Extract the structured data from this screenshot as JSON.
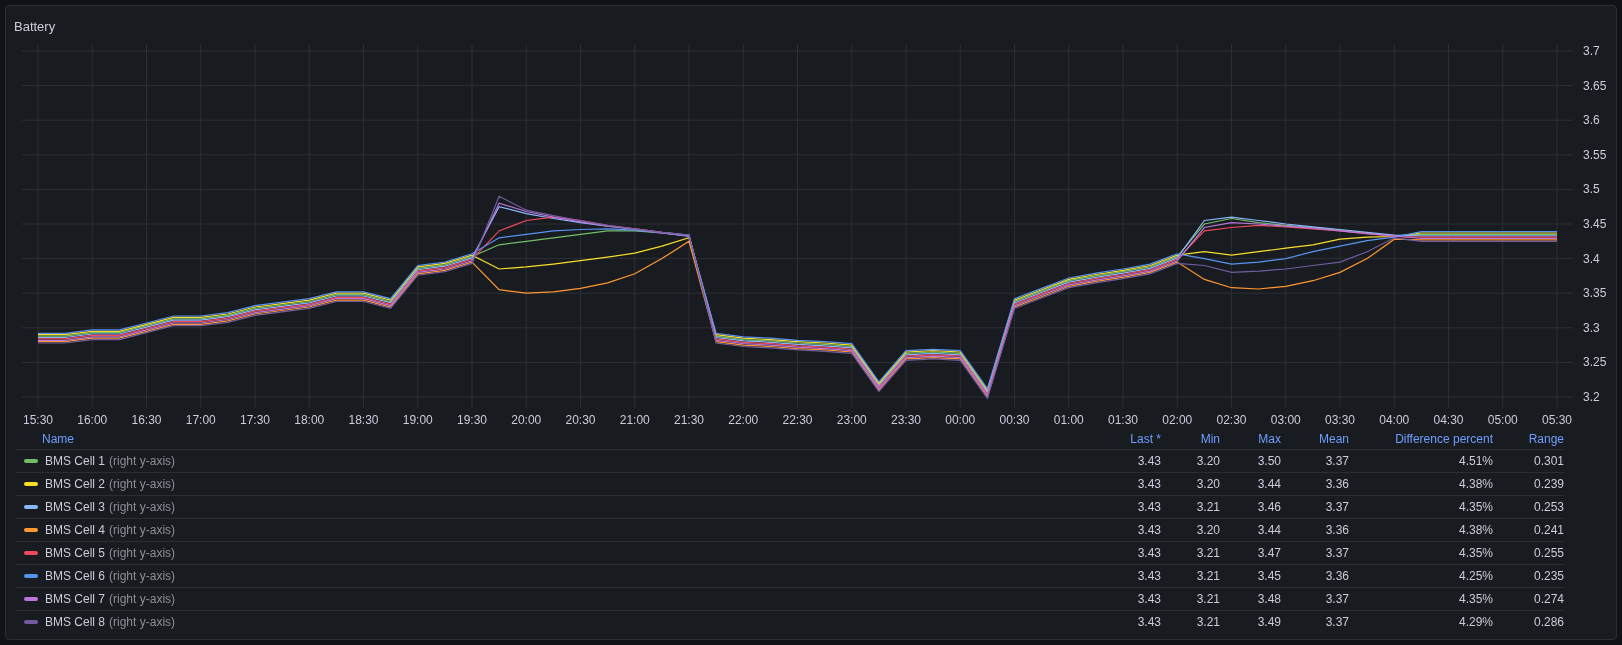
{
  "panel": {
    "title": "Battery"
  },
  "chart": {
    "chart_data": {
      "type": "line",
      "grid": true,
      "ylim": [
        3.185,
        3.71
      ],
      "categories": [
        "15:30",
        null,
        "16:00",
        null,
        "16:30",
        null,
        "17:00",
        null,
        "17:30",
        null,
        "18:00",
        null,
        "18:30",
        null,
        "19:00",
        null,
        "19:30",
        null,
        "20:00",
        null,
        "20:30",
        null,
        "21:00",
        null,
        "21:30",
        null,
        "22:00",
        null,
        "22:30",
        null,
        "23:00",
        null,
        "23:30",
        null,
        "00:00",
        null,
        "00:30",
        null,
        "01:00",
        null,
        "01:30",
        null,
        "02:00",
        null,
        "02:30",
        null,
        "03:00",
        null,
        "03:30",
        null,
        "04:00",
        null,
        "04:30",
        null,
        "05:00",
        null,
        "05:30"
      ],
      "yticks": [
        3.2,
        3.25,
        3.3,
        3.35,
        3.4,
        3.45,
        3.5,
        3.55,
        3.6,
        3.65,
        3.7
      ],
      "series": [
        {
          "color": "#73bf69",
          "values": [
            3.288,
            3.288,
            3.293,
            3.293,
            3.303,
            3.313,
            3.313,
            3.318,
            3.328,
            3.333,
            3.338,
            3.348,
            3.348,
            3.338,
            3.386,
            3.391,
            3.403,
            3.42,
            3.425,
            3.43,
            3.435,
            3.44,
            3.44,
            3.437,
            3.433,
            3.288,
            3.283,
            3.281,
            3.278,
            3.276,
            3.273,
            3.218,
            3.263,
            3.265,
            3.263,
            3.208,
            3.338,
            3.353,
            3.368,
            3.375,
            3.381,
            3.388,
            3.403,
            3.45,
            3.458,
            3.452,
            3.448,
            3.445,
            3.441,
            3.437,
            3.433,
            3.435,
            3.435,
            3.435,
            3.435,
            3.435,
            3.435
          ]
        },
        {
          "color": "#fade2a",
          "values": [
            3.29,
            3.29,
            3.295,
            3.295,
            3.305,
            3.315,
            3.315,
            3.32,
            3.33,
            3.335,
            3.34,
            3.35,
            3.35,
            3.34,
            3.388,
            3.393,
            3.405,
            3.385,
            3.388,
            3.392,
            3.397,
            3.402,
            3.408,
            3.418,
            3.43,
            3.29,
            3.285,
            3.283,
            3.28,
            3.278,
            3.275,
            3.22,
            3.265,
            3.267,
            3.265,
            3.21,
            3.34,
            3.355,
            3.37,
            3.377,
            3.383,
            3.39,
            3.405,
            3.41,
            3.405,
            3.41,
            3.415,
            3.42,
            3.428,
            3.431,
            3.432,
            3.437,
            3.437,
            3.437,
            3.437,
            3.437,
            3.437
          ]
        },
        {
          "color": "#8ab8ff",
          "values": [
            3.286,
            3.286,
            3.291,
            3.291,
            3.301,
            3.311,
            3.311,
            3.316,
            3.326,
            3.331,
            3.336,
            3.346,
            3.346,
            3.336,
            3.384,
            3.389,
            3.401,
            3.475,
            3.465,
            3.458,
            3.452,
            3.447,
            3.443,
            3.438,
            3.434,
            3.286,
            3.281,
            3.279,
            3.276,
            3.274,
            3.271,
            3.216,
            3.261,
            3.263,
            3.261,
            3.206,
            3.336,
            3.351,
            3.366,
            3.373,
            3.379,
            3.386,
            3.401,
            3.455,
            3.46,
            3.455,
            3.45,
            3.446,
            3.442,
            3.438,
            3.434,
            3.433,
            3.433,
            3.433,
            3.433,
            3.433,
            3.433
          ]
        },
        {
          "color": "#ff9830",
          "values": [
            3.28,
            3.28,
            3.285,
            3.285,
            3.295,
            3.305,
            3.305,
            3.31,
            3.32,
            3.325,
            3.33,
            3.34,
            3.34,
            3.33,
            3.378,
            3.383,
            3.395,
            3.355,
            3.35,
            3.352,
            3.357,
            3.365,
            3.378,
            3.4,
            3.425,
            3.28,
            3.275,
            3.273,
            3.27,
            3.268,
            3.265,
            3.21,
            3.255,
            3.257,
            3.255,
            3.2,
            3.33,
            3.345,
            3.36,
            3.367,
            3.373,
            3.38,
            3.395,
            3.37,
            3.358,
            3.356,
            3.36,
            3.368,
            3.38,
            3.4,
            3.428,
            3.427,
            3.427,
            3.427,
            3.427,
            3.427,
            3.427
          ]
        },
        {
          "color": "#f2495c",
          "values": [
            3.284,
            3.284,
            3.289,
            3.289,
            3.299,
            3.309,
            3.309,
            3.314,
            3.324,
            3.329,
            3.334,
            3.344,
            3.344,
            3.334,
            3.382,
            3.387,
            3.399,
            3.44,
            3.455,
            3.46,
            3.455,
            3.448,
            3.443,
            3.438,
            3.433,
            3.284,
            3.279,
            3.277,
            3.274,
            3.272,
            3.269,
            3.214,
            3.259,
            3.261,
            3.259,
            3.204,
            3.334,
            3.349,
            3.364,
            3.371,
            3.377,
            3.384,
            3.399,
            3.44,
            3.445,
            3.448,
            3.446,
            3.443,
            3.44,
            3.436,
            3.432,
            3.431,
            3.431,
            3.431,
            3.431,
            3.431,
            3.431
          ]
        },
        {
          "color": "#5794f2",
          "values": [
            3.292,
            3.292,
            3.297,
            3.297,
            3.307,
            3.317,
            3.317,
            3.322,
            3.332,
            3.337,
            3.342,
            3.352,
            3.352,
            3.342,
            3.39,
            3.395,
            3.407,
            3.43,
            3.435,
            3.44,
            3.442,
            3.443,
            3.441,
            3.437,
            3.432,
            3.292,
            3.287,
            3.285,
            3.282,
            3.28,
            3.277,
            3.222,
            3.267,
            3.269,
            3.267,
            3.212,
            3.342,
            3.357,
            3.372,
            3.379,
            3.385,
            3.392,
            3.407,
            3.4,
            3.392,
            3.395,
            3.4,
            3.41,
            3.418,
            3.426,
            3.431,
            3.439,
            3.439,
            3.439,
            3.439,
            3.439,
            3.439
          ]
        },
        {
          "color": "#b877d9",
          "values": [
            3.282,
            3.282,
            3.287,
            3.287,
            3.297,
            3.307,
            3.307,
            3.312,
            3.322,
            3.327,
            3.332,
            3.342,
            3.342,
            3.332,
            3.38,
            3.385,
            3.397,
            3.48,
            3.468,
            3.46,
            3.453,
            3.447,
            3.442,
            3.437,
            3.433,
            3.282,
            3.277,
            3.275,
            3.272,
            3.27,
            3.267,
            3.212,
            3.257,
            3.259,
            3.257,
            3.202,
            3.332,
            3.347,
            3.362,
            3.369,
            3.375,
            3.382,
            3.397,
            3.445,
            3.452,
            3.45,
            3.447,
            3.444,
            3.44,
            3.436,
            3.433,
            3.429,
            3.429,
            3.429,
            3.429,
            3.429,
            3.429
          ]
        },
        {
          "color": "#705da0",
          "values": [
            3.278,
            3.278,
            3.283,
            3.283,
            3.293,
            3.303,
            3.303,
            3.308,
            3.318,
            3.323,
            3.328,
            3.338,
            3.338,
            3.328,
            3.376,
            3.381,
            3.393,
            3.49,
            3.47,
            3.462,
            3.455,
            3.448,
            3.443,
            3.438,
            3.434,
            3.278,
            3.273,
            3.271,
            3.268,
            3.266,
            3.263,
            3.208,
            3.253,
            3.255,
            3.253,
            3.198,
            3.328,
            3.343,
            3.358,
            3.365,
            3.371,
            3.378,
            3.393,
            3.39,
            3.38,
            3.382,
            3.385,
            3.39,
            3.395,
            3.41,
            3.43,
            3.425,
            3.425,
            3.425,
            3.425,
            3.425,
            3.425
          ]
        }
      ]
    }
  },
  "legend": {
    "name_header": "Name",
    "columns": [
      "Last *",
      "Min",
      "Max",
      "Mean",
      "Difference percent",
      "Range"
    ],
    "rows": [
      {
        "name": "BMS Cell 1",
        "note": "(right y-axis)",
        "cells": [
          "3.43",
          "3.20",
          "3.50",
          "3.37",
          "4.51%",
          "0.301"
        ]
      },
      {
        "name": "BMS Cell 2",
        "note": "(right y-axis)",
        "cells": [
          "3.43",
          "3.20",
          "3.44",
          "3.36",
          "4.38%",
          "0.239"
        ]
      },
      {
        "name": "BMS Cell 3",
        "note": "(right y-axis)",
        "cells": [
          "3.43",
          "3.21",
          "3.46",
          "3.37",
          "4.35%",
          "0.253"
        ]
      },
      {
        "name": "BMS Cell 4",
        "note": "(right y-axis)",
        "cells": [
          "3.43",
          "3.20",
          "3.44",
          "3.36",
          "4.38%",
          "0.241"
        ]
      },
      {
        "name": "BMS Cell 5",
        "note": "(right y-axis)",
        "cells": [
          "3.43",
          "3.21",
          "3.47",
          "3.37",
          "4.35%",
          "0.255"
        ]
      },
      {
        "name": "BMS Cell 6",
        "note": "(right y-axis)",
        "cells": [
          "3.43",
          "3.21",
          "3.45",
          "3.36",
          "4.25%",
          "0.235"
        ]
      },
      {
        "name": "BMS Cell 7",
        "note": "(right y-axis)",
        "cells": [
          "3.43",
          "3.21",
          "3.48",
          "3.37",
          "4.35%",
          "0.274"
        ]
      },
      {
        "name": "BMS Cell 8",
        "note": "(right y-axis)",
        "cells": [
          "3.43",
          "3.21",
          "3.49",
          "3.37",
          "4.29%",
          "0.286"
        ]
      }
    ]
  }
}
